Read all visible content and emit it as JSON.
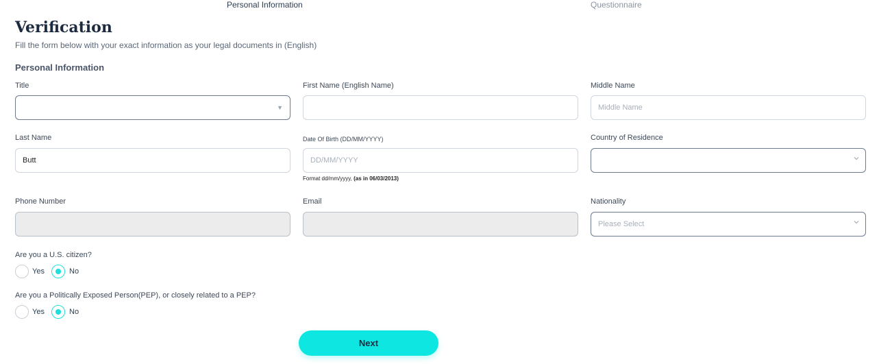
{
  "steps": [
    "Personal Information",
    "Questionnaire"
  ],
  "page": {
    "title": "Verification",
    "subtitle": "Fill the form below with your exact information as your legal documents in (English)",
    "section_title": "Personal Information"
  },
  "fields": {
    "title": {
      "label": "Title",
      "value": ""
    },
    "first_name": {
      "label": "First Name (English Name)",
      "value": ""
    },
    "middle_name": {
      "label": "Middle Name",
      "placeholder": "Middle Name"
    },
    "last_name": {
      "label": "Last Name",
      "value": "Butt"
    },
    "dob": {
      "label": "Date Of Birth  (DD/MM/YYYY)",
      "placeholder": "DD/MM/YYYY",
      "help_prefix": "Format dd/mm/yyyy, ",
      "help_bold": "(as in 06/03/2013)"
    },
    "country": {
      "label": "Country of Residence",
      "value": ""
    },
    "phone": {
      "label": "Phone Number",
      "value": ""
    },
    "email": {
      "label": "Email",
      "value": ""
    },
    "nationality": {
      "label": "Nationality",
      "placeholder": "Please Select"
    }
  },
  "questions": {
    "us_citizen": {
      "text": "Are you a U.S. citizen?",
      "yes": "Yes",
      "no": "No",
      "selected": "No"
    },
    "pep": {
      "text": "Are you a Politically Exposed Person(PEP), or closely related to a PEP?",
      "yes": "Yes",
      "no": "No",
      "selected": "No"
    }
  },
  "buttons": {
    "next": "Next"
  },
  "colors": {
    "accent": "#0ee7e1",
    "heading": "#1d2b40",
    "disabled_bg": "#ececec"
  },
  "icons": {
    "select_caret": "caret-down-icon",
    "chevron": "chevron-down-icon"
  }
}
